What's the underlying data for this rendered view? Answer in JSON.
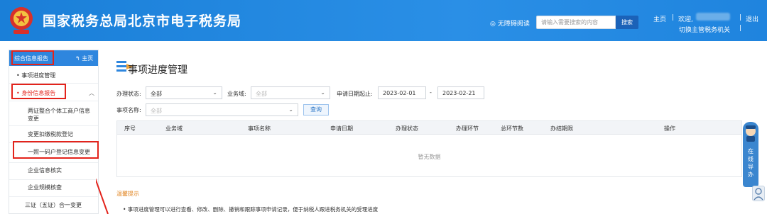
{
  "header": {
    "site_title": "国家税务总局北京市电子税务局",
    "accessibility": "无障碍阅读",
    "search_placeholder": "请输入需要搜索的内容",
    "search_button": "搜索",
    "home_link": "主页",
    "welcome": "欢迎,",
    "logout": "退出",
    "switch_tax_authority": "切换主管税务机关",
    "separator": "|"
  },
  "sidebar": {
    "header_title": "综合信息报告",
    "home_link": "主页",
    "items": [
      {
        "label": "事项进度管理"
      },
      {
        "label": "身份信息报告"
      }
    ],
    "sub_items": [
      {
        "label": "两证整合个体工商户信息变更"
      },
      {
        "label": "变更扣缴税款登记"
      },
      {
        "label": "一照一码户登记信息变更"
      },
      {
        "label": "企业信息核实"
      },
      {
        "label": "企业规模核查"
      },
      {
        "label": "三证（五证）合一变更"
      }
    ]
  },
  "main": {
    "title": "事项进度管理",
    "filters": {
      "status_label": "办理状态:",
      "status_value": "全部",
      "domain_label": "业务域:",
      "domain_value": "全部",
      "date_label": "申请日期起止:",
      "date_from": "2023-02-01",
      "date_dash": "-",
      "date_to": "2023-02-21",
      "item_label": "事项名称:",
      "item_value": "全部",
      "query_button": "查询"
    },
    "table": {
      "columns": [
        "序号",
        "业务域",
        "事项名称",
        "申请日期",
        "办理状态",
        "办理环节",
        "总环节数",
        "办结期限",
        "操作"
      ],
      "empty_text": "暂无数据"
    },
    "tips": {
      "title": "温馨提示",
      "line": "• 事项进度管理可以进行查看、修改、删除、撤销和跟踪事项申请记录，便于纳税人跟进税务机关的受理进度"
    }
  },
  "float_guide": {
    "text": "在线导办"
  },
  "colors": {
    "header_blue": "#1f84de",
    "sidebar_blue": "#2e86de",
    "highlight_red": "#e3231b",
    "tips_orange": "#e0801a"
  }
}
